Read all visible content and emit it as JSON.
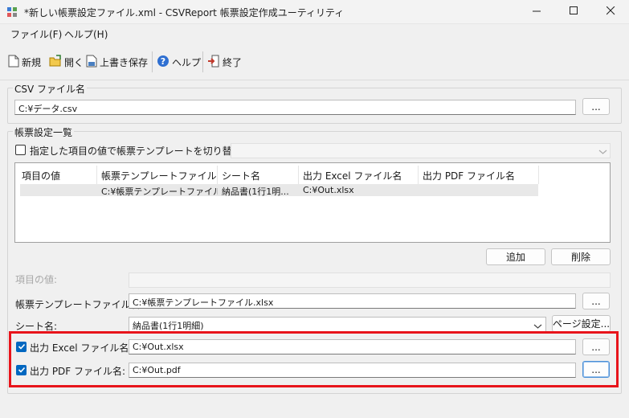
{
  "window": {
    "title": "*新しい帳票設定ファイル.xml - CSVReport 帳票設定作成ユーティリティ"
  },
  "menu": {
    "file": "ファイル(F)",
    "help": "ヘルプ(H)"
  },
  "toolbar": {
    "new_label": "新規",
    "open_label": "開く",
    "save_label": "上書き保存",
    "help_label": "ヘルプ",
    "exit_label": "終了"
  },
  "csv_group": {
    "label": "CSV ファイル名",
    "value": "C:¥データ.csv",
    "browse_label": "..."
  },
  "report_group": {
    "label": "帳票設定一覧",
    "switch_checkbox_label": "指定した項目の値で帳票テンプレートを切り替える:",
    "switch_checked": false,
    "switch_combo_value": "",
    "columns": [
      "項目の値",
      "帳票テンプレートファイル名",
      "シート名",
      "出力 Excel ファイル名",
      "出力 PDF ファイル名"
    ],
    "rows": [
      [
        "",
        "C:¥帳票テンプレートファイル...",
        "納品書(1行1明...",
        "C:¥Out.xlsx",
        ""
      ]
    ],
    "add_label": "追加",
    "delete_label": "削除"
  },
  "fields": {
    "item_value_label": "項目の値:",
    "item_value": "",
    "template_label": "帳票テンプレートファイル名:",
    "template_value": "C:¥帳票テンプレートファイル.xlsx",
    "template_browse": "...",
    "sheet_label": "シート名:",
    "sheet_value": "納品書(1行1明細)",
    "page_setup_label": "ページ設定...",
    "excel_checkbox_label": "出力 Excel ファイル名:",
    "excel_checked": true,
    "excel_value": "C:¥Out.xlsx",
    "excel_browse": "...",
    "pdf_checkbox_label": "出力 PDF ファイル名:",
    "pdf_checked": true,
    "pdf_value": "C:¥Out.pdf",
    "pdf_browse": "..."
  },
  "colors": {
    "highlight": "#e8141b",
    "checkbox_accent": "#0067c0"
  }
}
